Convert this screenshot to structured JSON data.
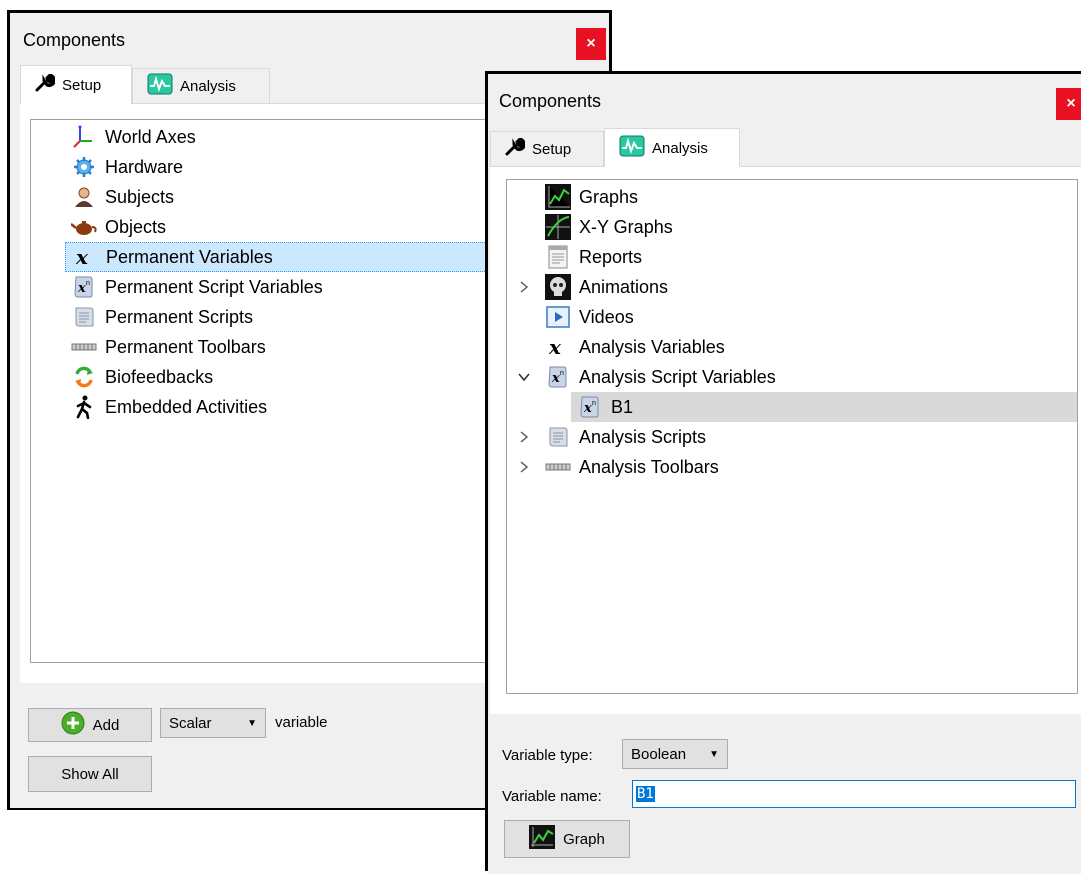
{
  "left_window": {
    "title": "Components",
    "close_glyph": "×",
    "tabs": [
      {
        "label": "Setup",
        "icon": "wrench-icon",
        "active": true
      },
      {
        "label": "Analysis",
        "icon": "waveform-icon",
        "active": false
      }
    ],
    "tree_items": [
      {
        "label": "World Axes",
        "icon": "axes-icon"
      },
      {
        "label": "Hardware",
        "icon": "gear-icon"
      },
      {
        "label": "Subjects",
        "icon": "person-icon"
      },
      {
        "label": "Objects",
        "icon": "teapot-icon"
      },
      {
        "label": "Permanent Variables",
        "icon": "variable-x-icon",
        "selected": true
      },
      {
        "label": "Permanent Script Variables",
        "icon": "script-variable-icon"
      },
      {
        "label": "Permanent Scripts",
        "icon": "scroll-icon"
      },
      {
        "label": "Permanent Toolbars",
        "icon": "toolbar-icon"
      },
      {
        "label": "Biofeedbacks",
        "icon": "feedback-arrows-icon"
      },
      {
        "label": "Embedded Activities",
        "icon": "walking-icon"
      }
    ],
    "add_button": "Add",
    "type_select": "Scalar",
    "variable_label": "variable",
    "show_all_button": "Show All"
  },
  "right_window": {
    "title": "Components",
    "close_glyph": "×",
    "tabs": [
      {
        "label": "Setup",
        "icon": "wrench-icon",
        "active": false
      },
      {
        "label": "Analysis",
        "icon": "waveform-icon",
        "active": true
      }
    ],
    "tree_items": [
      {
        "label": "Graphs",
        "icon": "graph-icon",
        "expander": "none"
      },
      {
        "label": "X-Y Graphs",
        "icon": "xy-graph-icon",
        "expander": "none"
      },
      {
        "label": "Reports",
        "icon": "report-icon",
        "expander": "none"
      },
      {
        "label": "Animations",
        "icon": "skull-icon",
        "expander": "collapsed"
      },
      {
        "label": "Videos",
        "icon": "video-icon",
        "expander": "none"
      },
      {
        "label": "Analysis Variables",
        "icon": "variable-x-icon",
        "expander": "none"
      },
      {
        "label": "Analysis Script Variables",
        "icon": "script-variable-icon",
        "expander": "expanded"
      },
      {
        "label": "B1",
        "icon": "script-variable-icon",
        "expander": "none",
        "child": true,
        "selected": true
      },
      {
        "label": "Analysis Scripts",
        "icon": "scroll-icon",
        "expander": "collapsed"
      },
      {
        "label": "Analysis Toolbars",
        "icon": "toolbar-icon",
        "expander": "collapsed"
      }
    ],
    "variable_type_label": "Variable type:",
    "variable_type_value": "Boolean",
    "variable_name_label": "Variable name:",
    "variable_name_value": "B1",
    "graph_button": "Graph"
  },
  "colors": {
    "window_bg": "#f0f0f0",
    "selection_blue": "#cce8ff",
    "selection_gray": "#d9d9d9",
    "close_red": "#e81123",
    "accent_blue": "#0078d7"
  }
}
